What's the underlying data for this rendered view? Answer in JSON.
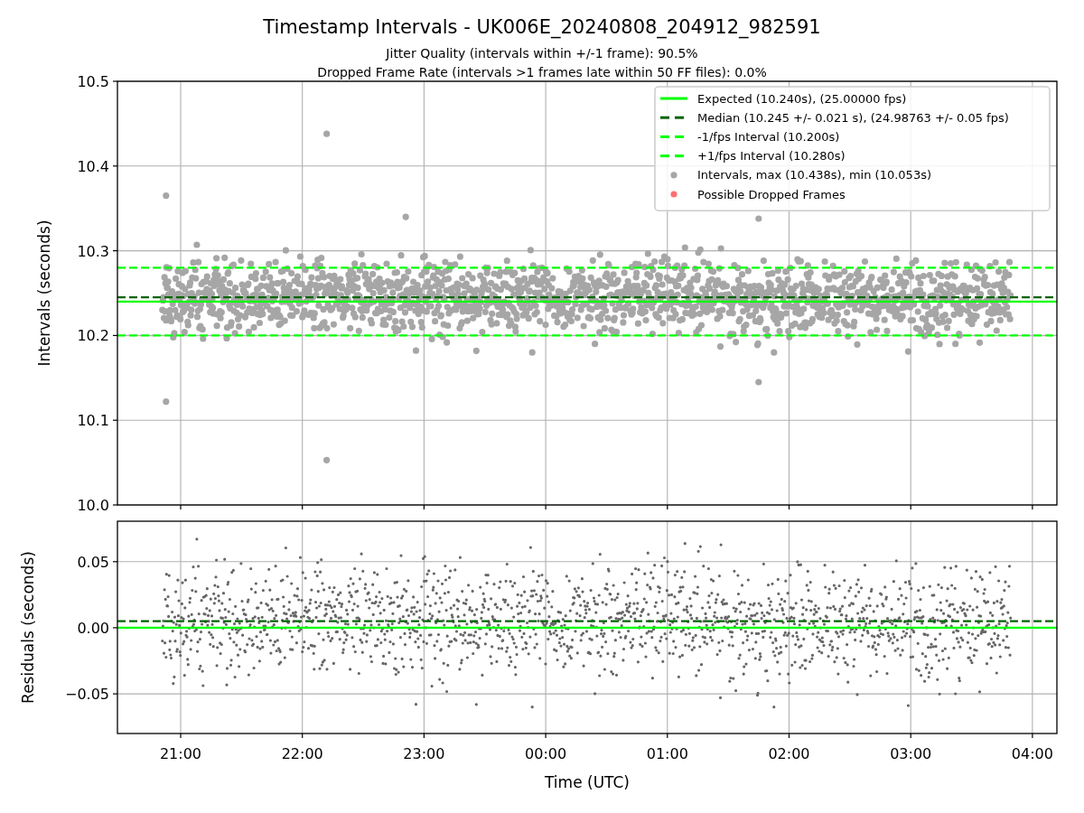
{
  "title": "Timestamp Intervals - UK006E_20240808_204912_982591",
  "subtitles": [
    "Jitter Quality (intervals within +/-1 frame): 90.5%",
    "Dropped Frame Rate (intervals >1 frames late within 50 FF files): 0.0%"
  ],
  "top_panel": {
    "y_axis_label": "Intervals (seconds)",
    "y_tick_labels": [
      "10.5",
      "10.4",
      "10.3",
      "10.2",
      "10.1",
      "10.0"
    ],
    "legend": [
      {
        "label": "Expected (10.240s), (25.00000 fps)",
        "color": "#00ff00",
        "kind": "solid"
      },
      {
        "label": "Median (10.245 +/- 0.021 s), (24.98763 +/- 0.05 fps)",
        "color": "#006400",
        "kind": "dashed"
      },
      {
        "label": "-1/fps Interval (10.200s)",
        "color": "#00ff00",
        "kind": "dashed"
      },
      {
        "label": "+1/fps Interval (10.280s)",
        "color": "#00ff00",
        "kind": "dashed"
      },
      {
        "label": "Intervals, max (10.438s), min (10.053s)",
        "color": "#a6a6a6",
        "kind": "dot"
      },
      {
        "label": "Possible Dropped Frames",
        "color": "#ff7070",
        "kind": "dot"
      }
    ]
  },
  "bottom_panel": {
    "y_axis_label": "Residuals (seconds)",
    "y_tick_labels": [
      "0.05",
      "0.00",
      "−0.05"
    ],
    "x_tick_labels": [
      "21:00",
      "22:00",
      "23:00",
      "00:00",
      "01:00",
      "02:00",
      "03:00",
      "04:00"
    ],
    "x_axis_label": "Time (UTC)"
  }
}
